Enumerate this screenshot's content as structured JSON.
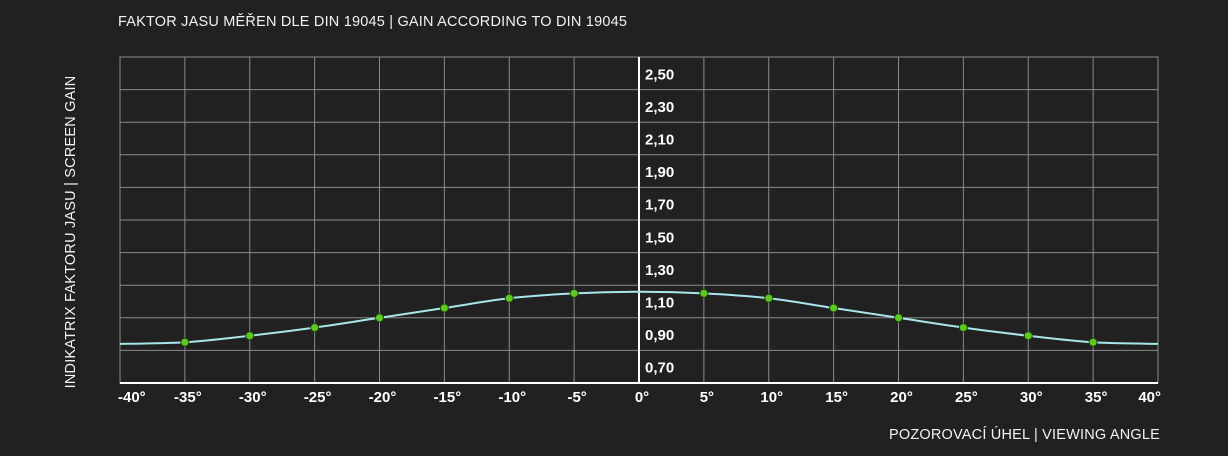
{
  "chart_data": {
    "type": "line",
    "title": "FAKTOR JASU MĚŘEN DLE DIN 19045 | GAIN ACCORDING TO DIN 19045",
    "xlabel": "POZOROVACÍ ÚHEL | VIEWING ANGLE",
    "ylabel": "INDIKATRIX FAKTORU JASU | SCREEN GAIN",
    "xlim": [
      -40,
      40
    ],
    "ylim": [
      0.6,
      2.6
    ],
    "x_ticks": [
      -40,
      -35,
      -30,
      -25,
      -20,
      -15,
      -10,
      -5,
      0,
      5,
      10,
      15,
      20,
      25,
      30,
      35,
      40
    ],
    "x_tick_labels": [
      "-40°",
      "-35°",
      "-30°",
      "-25°",
      "-20°",
      "-15°",
      "-10°",
      "-5°",
      "0°",
      "5°",
      "10°",
      "15°",
      "20°",
      "25°",
      "30°",
      "35°",
      "40°"
    ],
    "y_ticks": [
      0.7,
      0.9,
      1.1,
      1.3,
      1.5,
      1.7,
      1.9,
      2.1,
      2.3,
      2.5
    ],
    "y_tick_labels": [
      "0,70",
      "0,90",
      "1,10",
      "1,30",
      "1,50",
      "1,70",
      "1,90",
      "2,10",
      "2,30",
      "2,50"
    ],
    "grid": true,
    "series": [
      {
        "color": "#a8e6ec",
        "marker_color": "#5fc922",
        "points": [
          {
            "x": -35,
            "y": 0.85
          },
          {
            "x": -30,
            "y": 0.89
          },
          {
            "x": -25,
            "y": 0.94
          },
          {
            "x": -20,
            "y": 1.0
          },
          {
            "x": -15,
            "y": 1.06
          },
          {
            "x": -10,
            "y": 1.12
          },
          {
            "x": -5,
            "y": 1.15
          },
          {
            "x": 5,
            "y": 1.15
          },
          {
            "x": 10,
            "y": 1.12
          },
          {
            "x": 15,
            "y": 1.06
          },
          {
            "x": 20,
            "y": 1.0
          },
          {
            "x": 25,
            "y": 0.94
          },
          {
            "x": 30,
            "y": 0.89
          },
          {
            "x": 35,
            "y": 0.85
          }
        ],
        "curve": [
          {
            "x": -40,
            "y": 0.84
          },
          {
            "x": -35,
            "y": 0.85
          },
          {
            "x": -30,
            "y": 0.89
          },
          {
            "x": -25,
            "y": 0.94
          },
          {
            "x": -20,
            "y": 1.0
          },
          {
            "x": -15,
            "y": 1.06
          },
          {
            "x": -10,
            "y": 1.12
          },
          {
            "x": -5,
            "y": 1.15
          },
          {
            "x": 0,
            "y": 1.16
          },
          {
            "x": 5,
            "y": 1.15
          },
          {
            "x": 10,
            "y": 1.12
          },
          {
            "x": 15,
            "y": 1.06
          },
          {
            "x": 20,
            "y": 1.0
          },
          {
            "x": 25,
            "y": 0.94
          },
          {
            "x": 30,
            "y": 0.89
          },
          {
            "x": 35,
            "y": 0.85
          },
          {
            "x": 40,
            "y": 0.84
          }
        ]
      }
    ],
    "colors": {
      "background": "#212122",
      "grid": "#8a8a8a",
      "axis": "#ffffff",
      "line": "#a8e6ec",
      "marker": "#5fc922"
    }
  }
}
